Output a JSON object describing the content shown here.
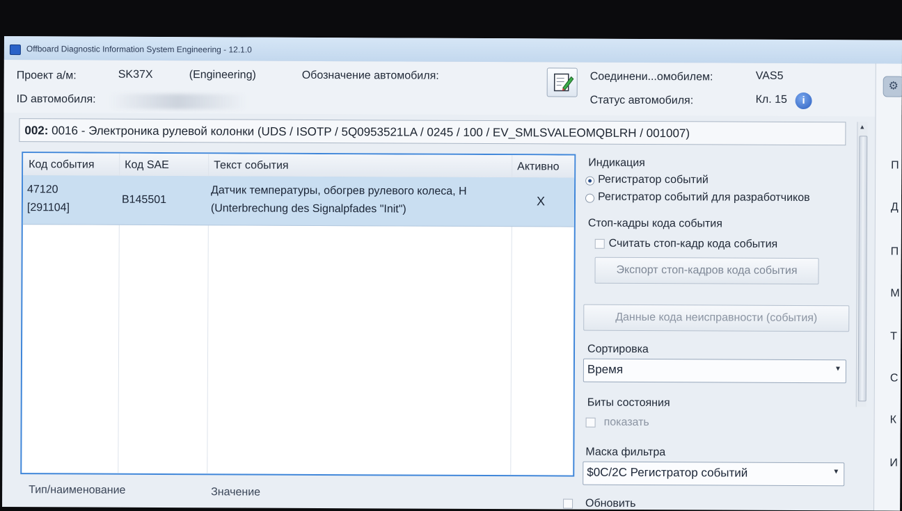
{
  "window": {
    "title": "Offboard Diagnostic Information System Engineering - 12.1.0"
  },
  "header": {
    "project_label": "Проект а/м:",
    "project_value": "SK37X",
    "project_mode": "(Engineering)",
    "vehicle_designation_label": "Обозначение автомобиля:",
    "vehicle_id_label": "ID автомобиля:",
    "connection_label": "Соединени...омобилем:",
    "connection_value": "VAS5",
    "vehicle_status_label": "Статус автомобиля:",
    "vehicle_status_value": "Кл. 15",
    "icons": {
      "edit": "edit-document-icon",
      "info": "info-icon"
    }
  },
  "ecu": {
    "address": "002:",
    "description": "0016 - Электроника рулевой колонки  (UDS / ISOTP / 5Q0953521LA / 0245 / 100 / EV_SMLSVALEOMQBLRH / 001007)"
  },
  "events_table": {
    "columns": [
      "Код события",
      "Код SAE",
      "Текст события",
      "Активно"
    ],
    "rows": [
      {
        "code": "47120",
        "code_sub": "[291104]",
        "sae": "B145501",
        "text": "Датчик температуры, обогрев рулевого колеса, Н",
        "text_sub": "(Unterbrechung des Signalpfades \"Init\")",
        "active": "X"
      }
    ]
  },
  "panel": {
    "indication_title": "Индикация",
    "radio_event_memory": "Регистратор событий",
    "radio_dev_event_memory": "Регистратор событий для разработчиков",
    "freeze_frames_title": "Стоп-кадры кода события",
    "read_freeze_frame": "Считать стоп-кадр кода события",
    "export_freeze_frames": "Экспорт стоп-кадров кода события",
    "fault_data_button": "Данные кода неисправности (события)",
    "sort_title": "Сортировка",
    "sort_value": "Время",
    "status_bits_title": "Биты состояния",
    "show_label": "показать",
    "filter_mask_title": "Маска фильтра",
    "filter_mask_value": "$0C/2C Регистратор событий",
    "refresh_label": "Обновить"
  },
  "details": {
    "col_type_name": "Тип/наименование",
    "col_value": "Значение"
  },
  "right_strip": {
    "items": [
      "П",
      "Д",
      "П",
      "М",
      "Т",
      "С",
      "К",
      "И"
    ]
  },
  "colors": {
    "selection": "#c9def1",
    "grid_border": "#3f86d9",
    "title_bar": "#c3d8ee"
  }
}
